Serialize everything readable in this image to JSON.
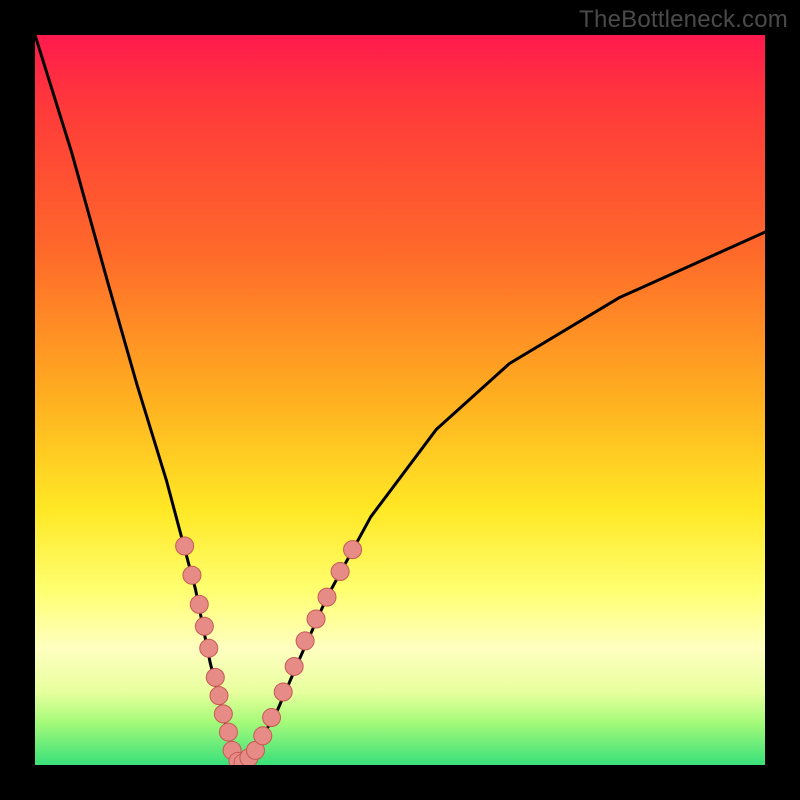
{
  "watermark": "TheBottleneck.com",
  "chart_data": {
    "type": "line",
    "title": "",
    "xlabel": "",
    "ylabel": "",
    "xlim": [
      0,
      1
    ],
    "ylim": [
      0,
      1
    ],
    "series": [
      {
        "name": "bottleneck-curve",
        "x": [
          0.0,
          0.05,
          0.1,
          0.14,
          0.18,
          0.22,
          0.24,
          0.26,
          0.27,
          0.28,
          0.3,
          0.33,
          0.36,
          0.4,
          0.46,
          0.55,
          0.65,
          0.8,
          1.0
        ],
        "values": [
          1.0,
          0.84,
          0.66,
          0.52,
          0.39,
          0.24,
          0.14,
          0.06,
          0.02,
          0.0,
          0.02,
          0.07,
          0.14,
          0.23,
          0.34,
          0.46,
          0.55,
          0.64,
          0.73
        ]
      }
    ],
    "markers": [
      {
        "x": 0.205,
        "y": 0.3
      },
      {
        "x": 0.215,
        "y": 0.26
      },
      {
        "x": 0.225,
        "y": 0.22
      },
      {
        "x": 0.232,
        "y": 0.19
      },
      {
        "x": 0.238,
        "y": 0.16
      },
      {
        "x": 0.247,
        "y": 0.12
      },
      {
        "x": 0.252,
        "y": 0.095
      },
      {
        "x": 0.258,
        "y": 0.07
      },
      {
        "x": 0.265,
        "y": 0.045
      },
      {
        "x": 0.27,
        "y": 0.02
      },
      {
        "x": 0.278,
        "y": 0.005
      },
      {
        "x": 0.285,
        "y": 0.003
      },
      {
        "x": 0.293,
        "y": 0.01
      },
      {
        "x": 0.302,
        "y": 0.02
      },
      {
        "x": 0.312,
        "y": 0.04
      },
      {
        "x": 0.324,
        "y": 0.065
      },
      {
        "x": 0.34,
        "y": 0.1
      },
      {
        "x": 0.355,
        "y": 0.135
      },
      {
        "x": 0.37,
        "y": 0.17
      },
      {
        "x": 0.385,
        "y": 0.2
      },
      {
        "x": 0.4,
        "y": 0.23
      },
      {
        "x": 0.418,
        "y": 0.265
      },
      {
        "x": 0.435,
        "y": 0.295
      }
    ],
    "marker_style": {
      "radius": 9,
      "fill": "#e78b87",
      "stroke": "#c55a55"
    },
    "curve_style": {
      "stroke": "#000000",
      "width": 3
    }
  }
}
